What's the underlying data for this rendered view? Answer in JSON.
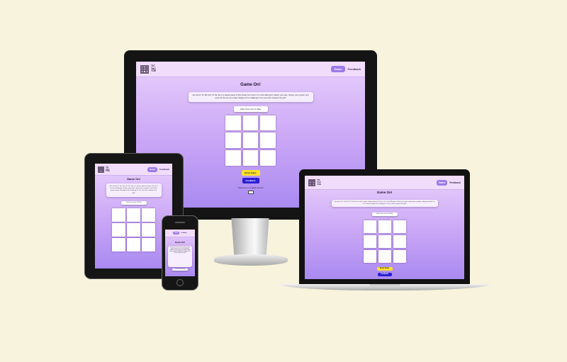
{
  "colors": {
    "background": "#f7f3dc",
    "nav_active": "#9b7ae8",
    "reset_button": "#ffe02b",
    "feedback_button": "#2a1fd6"
  },
  "site": {
    "logo_lines": [
      "TIC",
      "TAC",
      "TOE"
    ],
    "nav": {
      "game_label": "Game",
      "feedback_label": "Feedback"
    },
    "heading": "Game On!",
    "intro": "Get set for Tic Tac Toe! Tic Tac Toe is a classic game of who shows he's first to 3 in a line filled grid. Gather your pals, choose your symbol, and jump into the fun as a swap. Ready for the challenge? Let's see who conquers the grid!",
    "intro_short": "Get set for Tic Tac Toe! Tic Tac Toe is a classic game of who's first to 3 in a line filled grid. Gather your pals, choose your symbol, and let the games begin. Ready for the challenge? Let's see who conquers the grid!",
    "pick_button": "Click Once Icon To Play",
    "reset_button": "Reset Game",
    "feedback_button": "Feedback",
    "footer_text": "Follow me on my github account",
    "footer_icon": "github-icon"
  }
}
